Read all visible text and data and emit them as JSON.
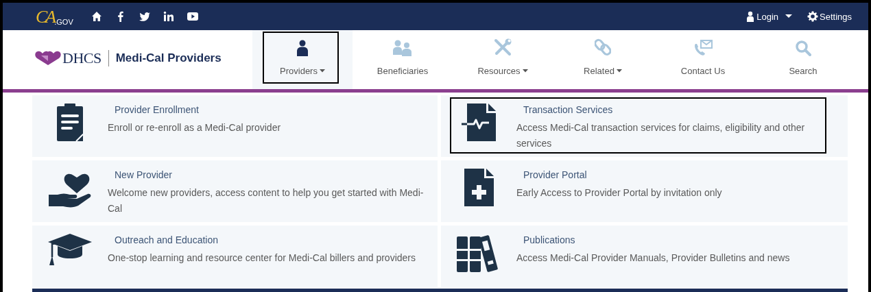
{
  "topbar": {
    "logo": {
      "mark": "CA",
      "suffix": ".GOV"
    },
    "login": "Login",
    "settings": "Settings"
  },
  "header": {
    "agency": "DHCS",
    "site_title": "Medi-Cal Providers"
  },
  "nav": [
    {
      "label": "Providers",
      "dropdown": true,
      "selected": true,
      "highlighted": true
    },
    {
      "label": "Beneficiaries",
      "dropdown": false,
      "selected": false,
      "highlighted": false
    },
    {
      "label": "Resources",
      "dropdown": true,
      "selected": false,
      "highlighted": false
    },
    {
      "label": "Related",
      "dropdown": true,
      "selected": false,
      "highlighted": false
    },
    {
      "label": "Contact Us",
      "dropdown": false,
      "selected": false,
      "highlighted": false
    },
    {
      "label": "Search",
      "dropdown": false,
      "selected": false,
      "highlighted": false
    }
  ],
  "menu": [
    {
      "title": "Provider Enrollment",
      "description": "Enroll or re-enroll as a Medi-Cal provider",
      "highlighted": false
    },
    {
      "title": "Transaction Services",
      "description": "Access Medi-Cal transaction services for claims, eligibility and other services",
      "highlighted": true
    },
    {
      "title": "New Provider",
      "description": "Welcome new providers, access content to help you get started with Medi-Cal",
      "highlighted": false
    },
    {
      "title": "Provider Portal",
      "description": "Early Access to Provider Portal by invitation only",
      "highlighted": false
    },
    {
      "title": "Outreach and Education",
      "description": "One-stop learning and resource center for Medi-Cal billers and providers",
      "highlighted": false
    },
    {
      "title": "Publications",
      "description": "Access Medi-Cal Provider Manuals, Provider Bulletins and news",
      "highlighted": false
    }
  ]
}
